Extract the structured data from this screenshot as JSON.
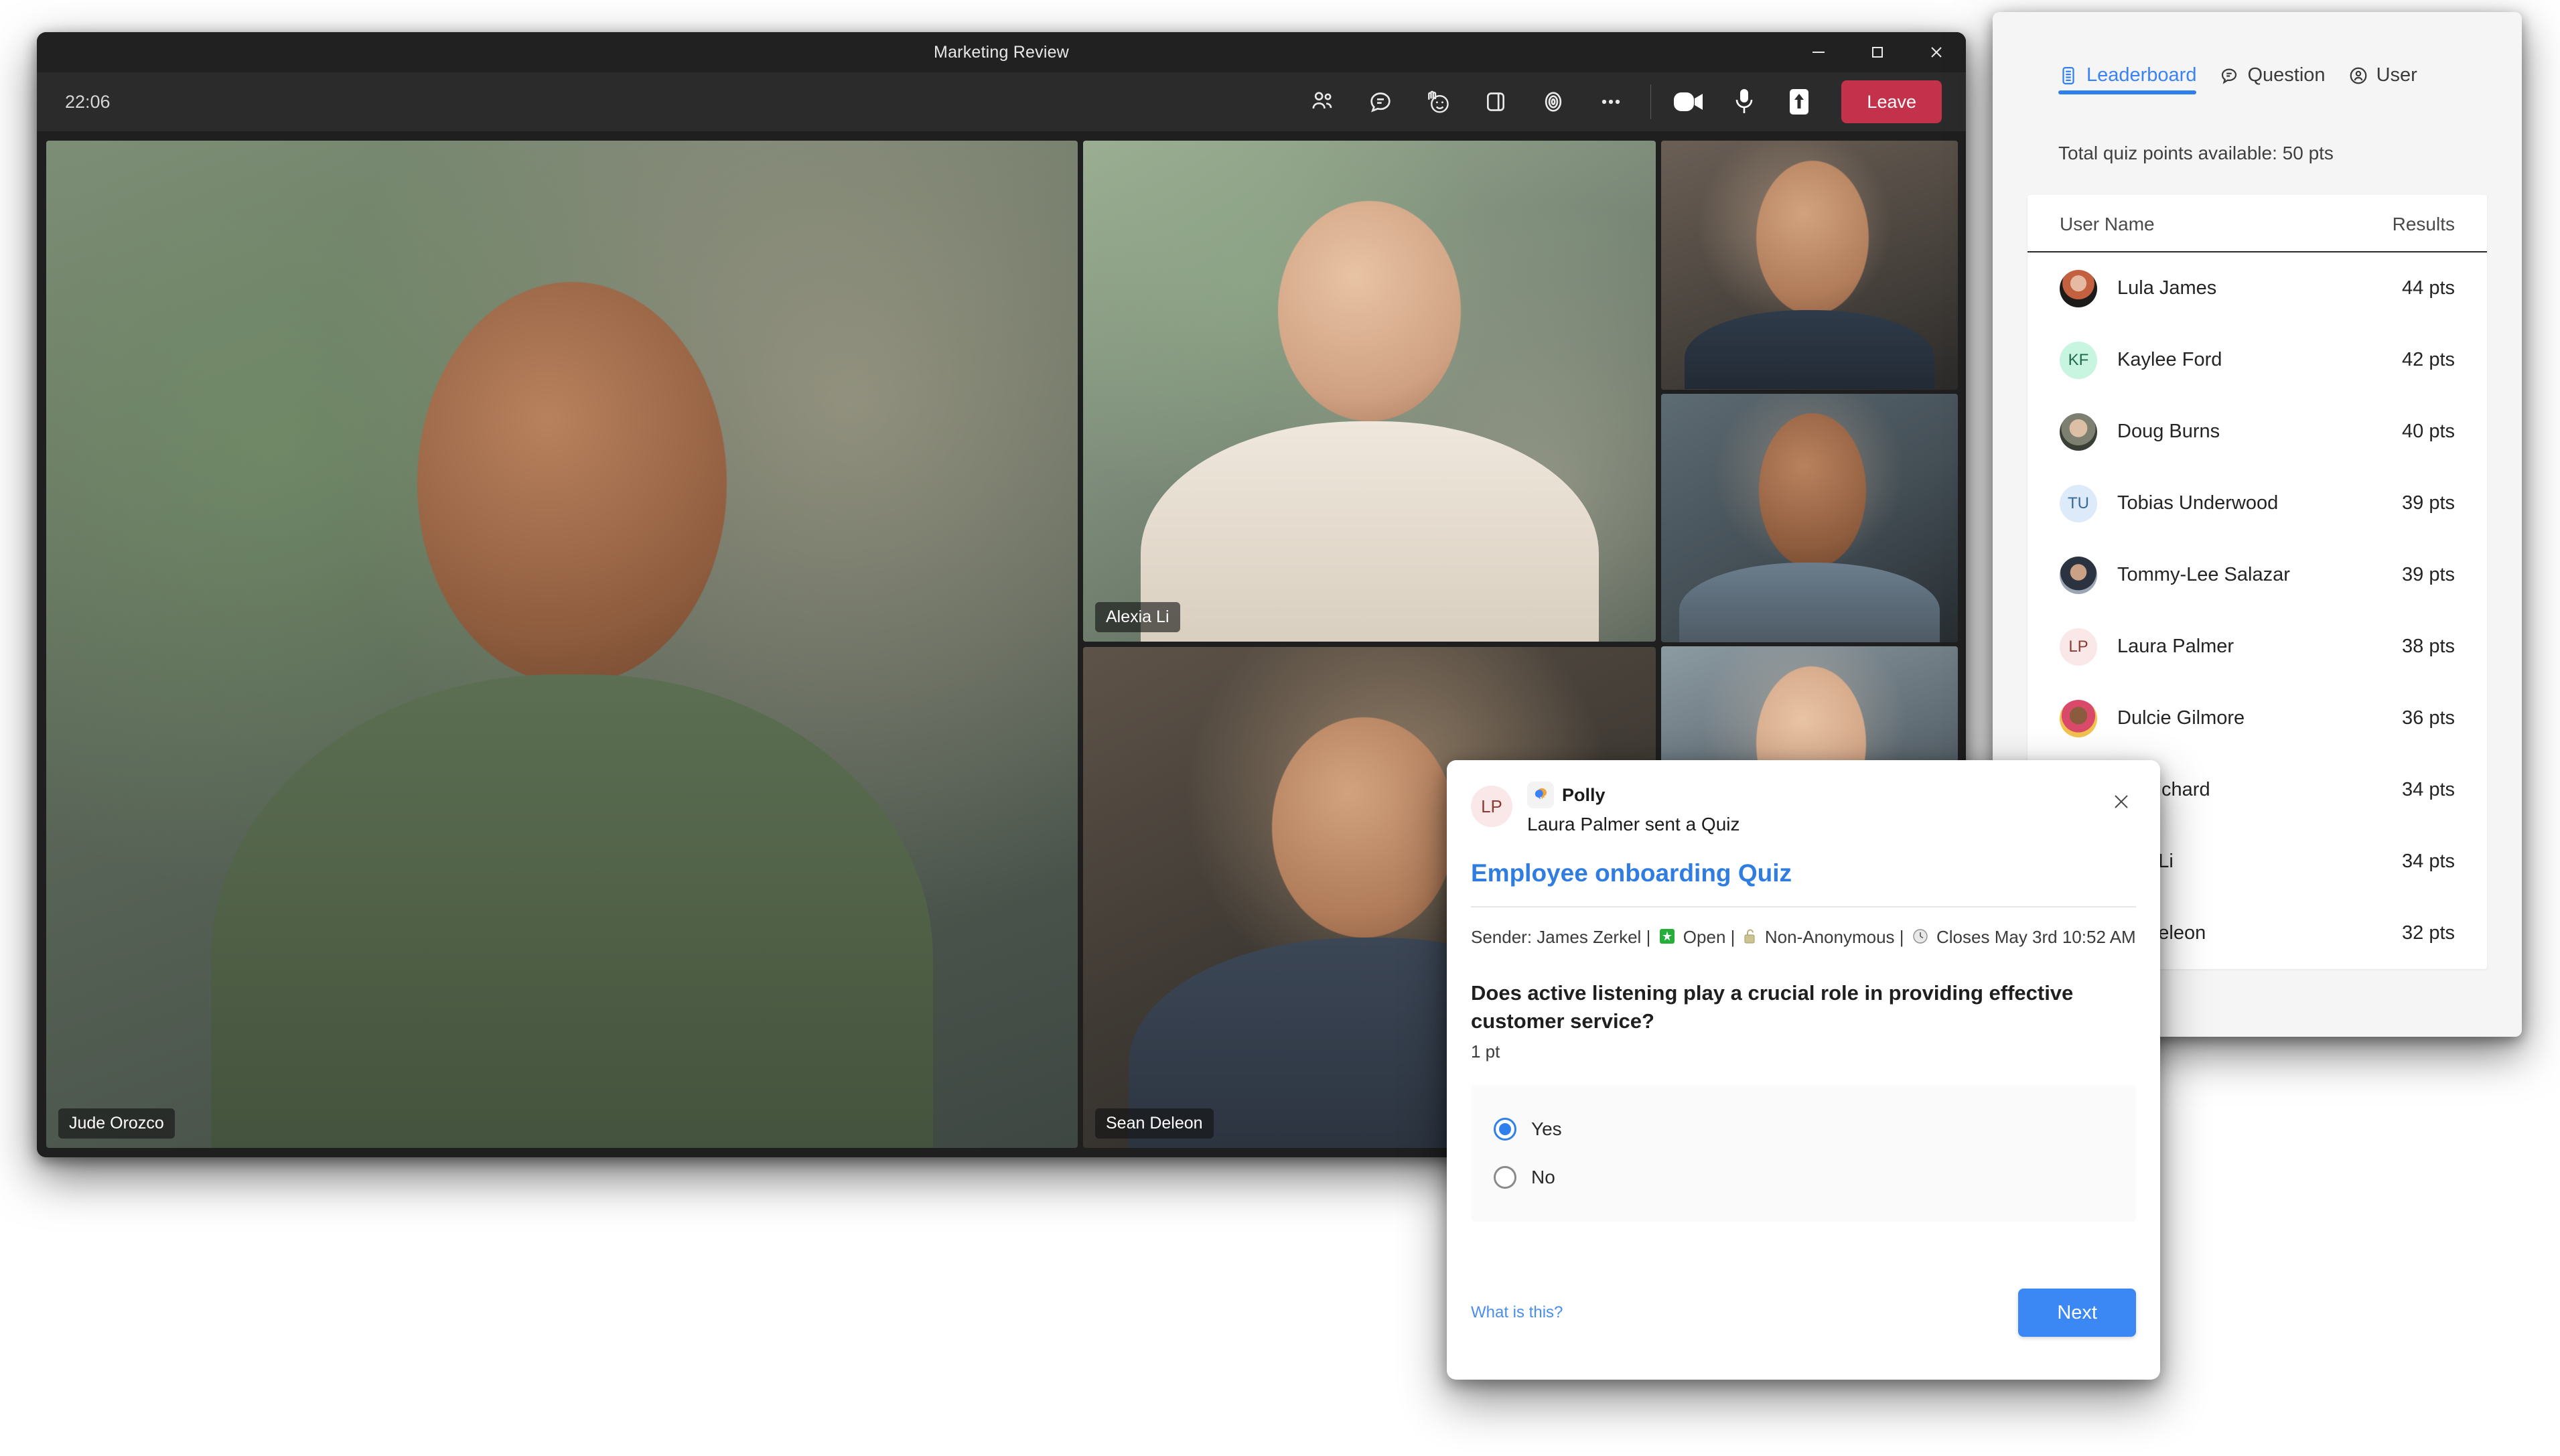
{
  "teams_window": {
    "title": "Marketing Review",
    "timer": "22:06",
    "window_controls": {
      "minimize": "minimize-icon",
      "maximize": "maximize-icon",
      "close": "close-icon"
    },
    "toolbar": {
      "people_icon": "people-icon",
      "chat_icon": "chat-icon",
      "reactions_icon": "reactions-raise-hand-icon",
      "rooms_icon": "breakout-rooms-icon",
      "copilot_icon": "copilot-icon",
      "more_icon": "more-options-icon",
      "camera_icon": "camera-icon",
      "mic_icon": "microphone-icon",
      "share_icon": "share-screen-icon",
      "leave_label": "Leave"
    },
    "participants": [
      {
        "name": "Jude Orozco"
      },
      {
        "name": "Alexia Li"
      },
      {
        "name": "Sean Deleon"
      }
    ]
  },
  "leaderboard_panel": {
    "tabs": [
      {
        "label": "Leaderboard",
        "icon": "leaderboard-icon",
        "active": true
      },
      {
        "label": "Question",
        "icon": "question-chat-icon",
        "active": false
      },
      {
        "label": "User",
        "icon": "user-circle-icon",
        "active": false
      }
    ],
    "total_points_text": "Total quiz points available: 50 pts",
    "table": {
      "columns": [
        "User Name",
        "Results"
      ],
      "rows": [
        {
          "name": "Lula James",
          "points": "44 pts",
          "avatar_type": "photo",
          "avatar_class": "ph1",
          "initials": ""
        },
        {
          "name": "Kaylee Ford",
          "points": "42 pts",
          "avatar_type": "initials",
          "avatar_bg": "#c8f5e0",
          "avatar_fg": "#1f6b50",
          "initials": "KF"
        },
        {
          "name": "Doug Burns",
          "points": "40 pts",
          "avatar_type": "photo",
          "avatar_class": "ph2",
          "initials": ""
        },
        {
          "name": "Tobias Underwood",
          "points": "39 pts",
          "avatar_type": "initials",
          "avatar_bg": "#dceaf9",
          "avatar_fg": "#3a6a93",
          "initials": "TU"
        },
        {
          "name": "Tommy-Lee Salazar",
          "points": "39 pts",
          "avatar_type": "photo",
          "avatar_class": "ph3",
          "initials": ""
        },
        {
          "name": "Laura Palmer",
          "points": "38 pts",
          "avatar_type": "initials",
          "avatar_bg": "#fae8e8",
          "avatar_fg": "#8c3b33",
          "initials": "LP"
        },
        {
          "name": "Dulcie Gilmore",
          "points": "36 pts",
          "avatar_type": "photo",
          "avatar_class": "ph4",
          "initials": ""
        },
        {
          "name": "ris Richard",
          "points": "34 pts",
          "avatar_type": "hidden",
          "initials": ""
        },
        {
          "name": "exia Li",
          "points": "34 pts",
          "avatar_type": "hidden",
          "initials": ""
        },
        {
          "name": "an Deleon",
          "points": "32 pts",
          "avatar_type": "hidden",
          "initials": ""
        }
      ]
    }
  },
  "quiz_dialog": {
    "sender_avatar_initials": "LP",
    "app_name": "Polly",
    "app_icon": "polly-app-icon",
    "sent_line": "Laura Palmer sent a Quiz",
    "close_icon": "close-icon",
    "quiz_title": "Employee onboarding Quiz",
    "meta": {
      "sender": "Sender: James Zerkel",
      "separator": "|",
      "status_icon": "green-open-icon",
      "status": "Open",
      "anonymity_icon": "unlocked-padlock-icon",
      "anonymity": "Non-Anonymous",
      "clock_icon": "clock-icon",
      "closes": "Closes May 3rd 10:52 AM"
    },
    "question": "Does active listening play a crucial role in providing effective customer service?",
    "points": "1 pt",
    "options": [
      {
        "label": "Yes",
        "selected": true
      },
      {
        "label": "No",
        "selected": false
      }
    ],
    "what_is_this": "What is this?",
    "next_label": "Next"
  },
  "colors": {
    "accent_blue": "#2f80ed",
    "leave_red": "#c4314b",
    "next_blue": "#3b88f5",
    "quiz_title_blue": "#2f7de1"
  }
}
